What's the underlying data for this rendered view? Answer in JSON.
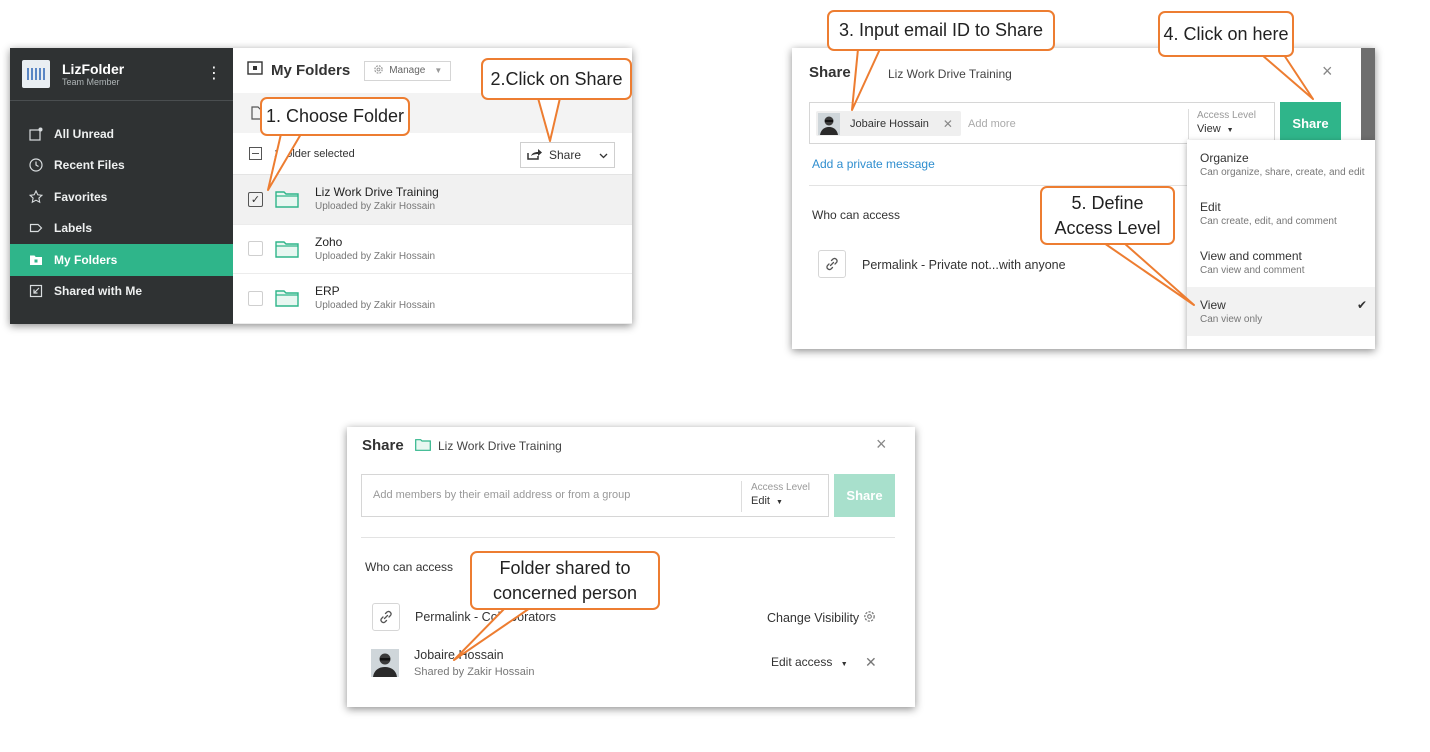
{
  "panel1": {
    "app_name": "LizFolder",
    "user_role": "Team Member",
    "nav": [
      {
        "label": "All Unread",
        "icon": "unread-icon"
      },
      {
        "label": "Recent Files",
        "icon": "clock-icon"
      },
      {
        "label": "Favorites",
        "icon": "star-icon"
      },
      {
        "label": "Labels",
        "icon": "label-icon"
      },
      {
        "label": "My Folders",
        "icon": "folder-icon",
        "active": true
      },
      {
        "label": "Shared with Me",
        "icon": "shared-icon"
      }
    ],
    "header_title": "My Folders",
    "manage_label": "Manage",
    "selected_text": "1 folder selected",
    "share_label": "Share",
    "rows": [
      {
        "name": "Liz Work Drive Training",
        "sub": "Uploaded by Zakir Hossain",
        "checked": true
      },
      {
        "name": "Zoho",
        "sub": "Uploaded by Zakir Hossain",
        "checked": false
      },
      {
        "name": "ERP",
        "sub": "Uploaded by Zakir Hossain",
        "checked": false
      }
    ]
  },
  "panel2": {
    "title": "Share",
    "folder_name": "Liz Work Drive Training",
    "chip_name": "Jobaire Hossain",
    "add_more_placeholder": "Add more",
    "access_label": "Access Level",
    "access_value": "View",
    "share_button": "Share",
    "private_message": "Add a private message",
    "who_can_access": "Who can access",
    "permalink": "Permalink - Private not...with anyone",
    "menu": [
      {
        "name": "Organize",
        "desc": "Can organize, share, create, and edit",
        "selected": false
      },
      {
        "name": "Edit",
        "desc": "Can create, edit, and comment",
        "selected": false
      },
      {
        "name": "View and comment",
        "desc": "Can view and comment",
        "selected": false
      },
      {
        "name": "View",
        "desc": "Can view only",
        "selected": true
      }
    ]
  },
  "panel3": {
    "title": "Share",
    "folder_name": "Liz Work Drive Training",
    "input_placeholder": "Add members by their email address or from a group",
    "access_label": "Access Level",
    "access_value": "Edit",
    "share_button": "Share",
    "who_can_access": "Who can access",
    "permalink": "Permalink - Collaborators",
    "change_visibility": "Change Visibility",
    "person_name": "Jobaire Hossain",
    "person_sub": "Shared by Zakir Hossain",
    "edit_access": "Edit access"
  },
  "callouts": {
    "c1": "1. Choose Folder",
    "c2": "2.Click on Share",
    "c3": "3. Input email ID to Share",
    "c4": "4. Click on here",
    "c5": "5. Define\nAccess Level",
    "c6": "Folder shared to\nconcerned person"
  },
  "colors": {
    "accent": "#2fb58a",
    "callout_border": "#ed7d31",
    "sidebar": "#2f3233",
    "link": "#2f8ecf"
  }
}
